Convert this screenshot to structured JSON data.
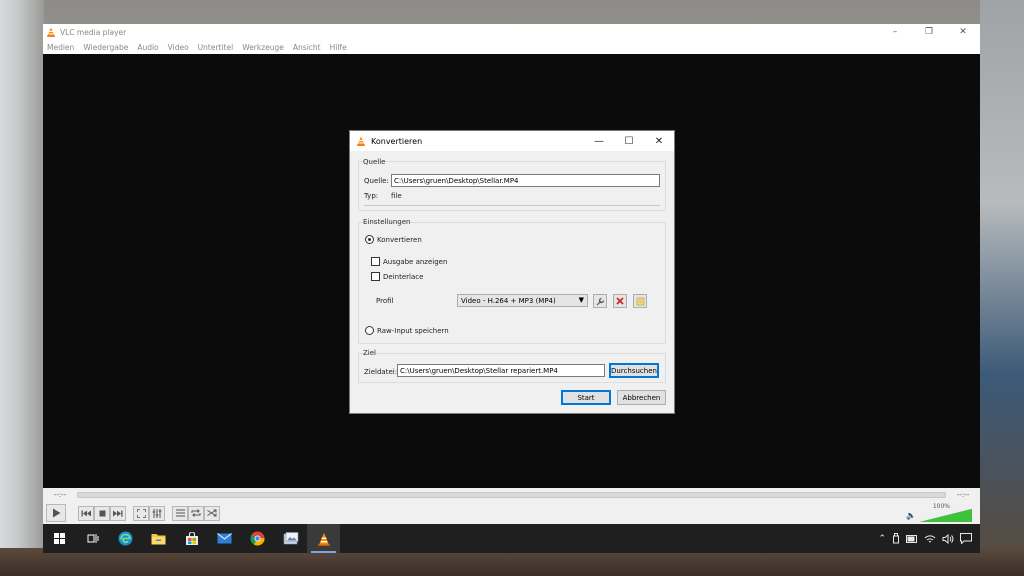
{
  "vlc_window": {
    "title": "VLC media player",
    "menu": [
      "Medien",
      "Wiedergabe",
      "Audio",
      "Video",
      "Untertitel",
      "Werkzeuge",
      "Ansicht",
      "Hilfe"
    ],
    "window_controls": {
      "minimize": "–",
      "restore": "❐",
      "close": "✕"
    }
  },
  "controls": {
    "time_elapsed": "--:--",
    "time_total": "--:--",
    "volume_percent": "100%",
    "volume_level": 1.0
  },
  "dialog": {
    "title": "Konvertieren",
    "window_controls": {
      "minimize": "—",
      "maximize": "☐",
      "close": "✕"
    },
    "source_group": {
      "label": "Quelle",
      "source_label": "Quelle:",
      "source_value": "C:\\Users\\gruen\\Desktop\\Stellar.MP4",
      "type_label": "Typ:",
      "type_value": "file"
    },
    "settings_group": {
      "label": "Einstellungen",
      "convert_label": "Konvertieren",
      "convert_selected": true,
      "show_output_label": "Ausgabe anzeigen",
      "show_output_checked": false,
      "deinterlace_label": "Deinterlace",
      "deinterlace_checked": false,
      "profile_label": "Profil",
      "profile_value": "Video - H.264 + MP3 (MP4)",
      "raw_input_label": "Raw-Input speichern",
      "raw_input_selected": false
    },
    "target_group": {
      "label": "Ziel",
      "dest_label": "Zieldatei:",
      "dest_value": "C:\\Users\\gruen\\Desktop\\Stellar repariert.MP4",
      "browse_label": "Durchsuchen"
    },
    "start_label": "Start",
    "cancel_label": "Abbrechen"
  },
  "taskbar": {
    "icons": [
      "windows-start-icon",
      "task-view-icon",
      "edge-icon",
      "file-explorer-icon",
      "store-icon",
      "mail-icon",
      "chrome-icon",
      "photos-icon",
      "vlc-icon"
    ]
  },
  "colors": {
    "vlc_orange": "#ff8800",
    "accent_blue": "#0078d7",
    "volume_green": "#3cc23c"
  }
}
